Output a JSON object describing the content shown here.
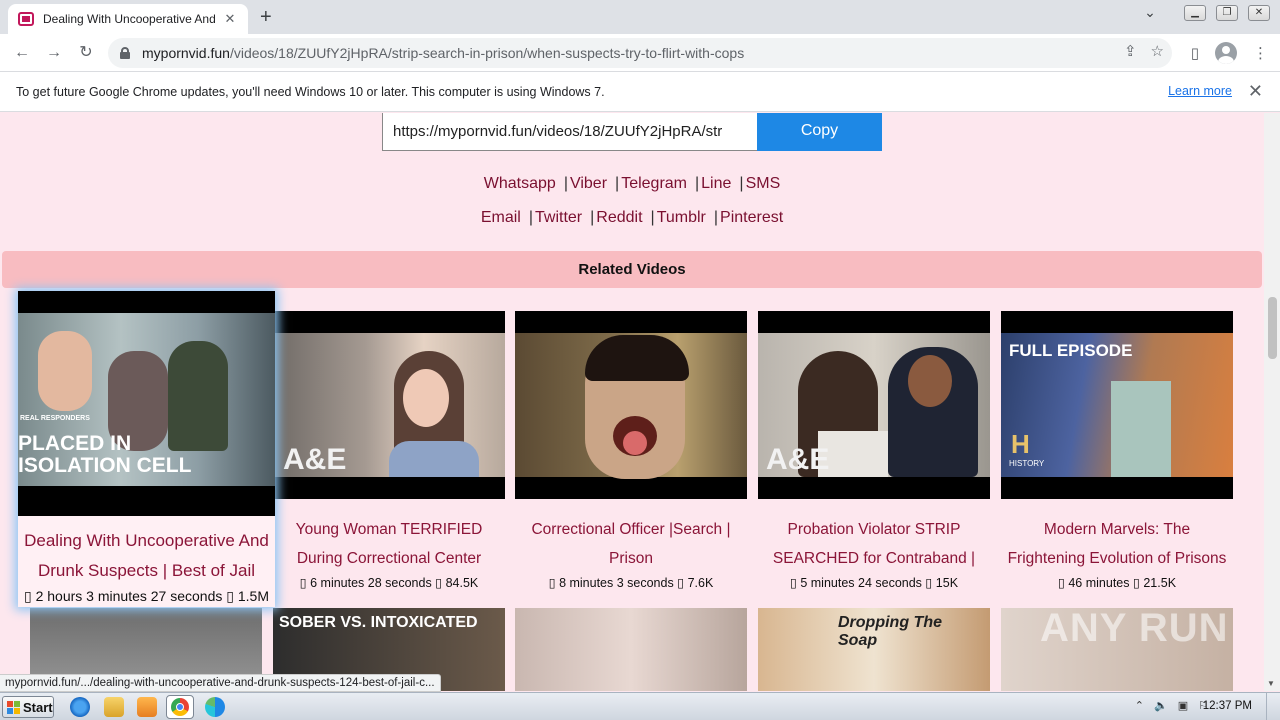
{
  "browser": {
    "tab_title": "Dealing With Uncooperative And Dru",
    "url_host": "mypornvid.fun",
    "url_path": "/videos/18/ZUUfY2jHpRA/strip-search-in-prison/when-suspects-try-to-flirt-with-cops",
    "infobar_text": "To get future Google Chrome updates, you'll need Windows 10 or later. This computer is using Windows 7.",
    "infobar_link": "Learn more",
    "status_url": "mypornvid.fun/.../dealing-with-uncooperative-and-drunk-suspects-124-best-of-jail-c..."
  },
  "share": {
    "copy_value": "https://mypornvid.fun/videos/18/ZUUfY2jHpRA/str",
    "copy_label": "Copy",
    "row1": [
      "Whatsapp",
      "Viber",
      "Telegram",
      "Line",
      "SMS"
    ],
    "row2": [
      "Email",
      "Twitter",
      "Reddit",
      "Tumblr",
      "Pinterest"
    ]
  },
  "related": {
    "heading": "Related Videos",
    "cards": [
      {
        "title": "Dealing With Uncooperative And Drunk Suspects | Best of Jail",
        "duration": "2 hours 3 minutes 27 seconds",
        "views": "1.5M",
        "thumb_text": "PLACED IN ISOLATION CELL",
        "thumb_badge": "REAL RESPONDERS"
      },
      {
        "title": "Young Woman TERRIFIED During Correctional Center",
        "duration": "6 minutes 28 seconds",
        "views": "84.5K",
        "thumb_text": "A&E"
      },
      {
        "title": "Correctional Officer |Search | Prison",
        "duration": "8 minutes 3 seconds",
        "views": "7.6K",
        "thumb_text": ""
      },
      {
        "title": "Probation Violator STRIP SEARCHED for Contraband |",
        "duration": "5 minutes 24 seconds",
        "views": "15K",
        "thumb_text": "A&E"
      },
      {
        "title": "Modern Marvels: The Frightening Evolution of Prisons",
        "duration": "46 minutes",
        "views": "21.5K",
        "thumb_text": "FULL EPISODE",
        "thumb_badge": "HISTORY"
      }
    ],
    "row2_texts": [
      "",
      "SOBER VS. INTOXICATED",
      "",
      "Dropping The Soap",
      ""
    ]
  },
  "watermark": "ANY RUN",
  "taskbar": {
    "start_label": "Start",
    "clock": "12:37 PM"
  }
}
